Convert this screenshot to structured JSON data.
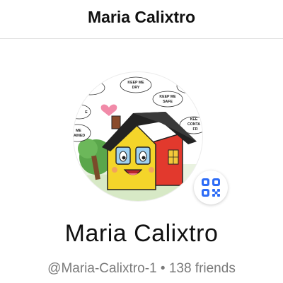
{
  "header": {
    "title": "Maria Calixtro"
  },
  "profile": {
    "avatar_bubbles": {
      "dry": "KEEP ME\nDRY",
      "safe": "KEEP ME\nSAFE",
      "contact_partial": "KEE\nCONTA\nFR",
      "left_top_partial": "E",
      "left_bottom_partial": "ME\nAINED",
      "right_top_partial": "V"
    },
    "display_name": "Maria Calixtro",
    "username": "@Maria-Calixtro-1",
    "separator": "•",
    "friends": "138 friends"
  },
  "icons": {
    "qr": "qr-code-icon",
    "heart": "heart-icon"
  },
  "colors": {
    "accent": "#2f6df6",
    "house_yellow": "#f4d52a",
    "house_red": "#e2392d",
    "roof": "#222222",
    "tree": "#5aa64b",
    "heart": "#f18aa8"
  }
}
